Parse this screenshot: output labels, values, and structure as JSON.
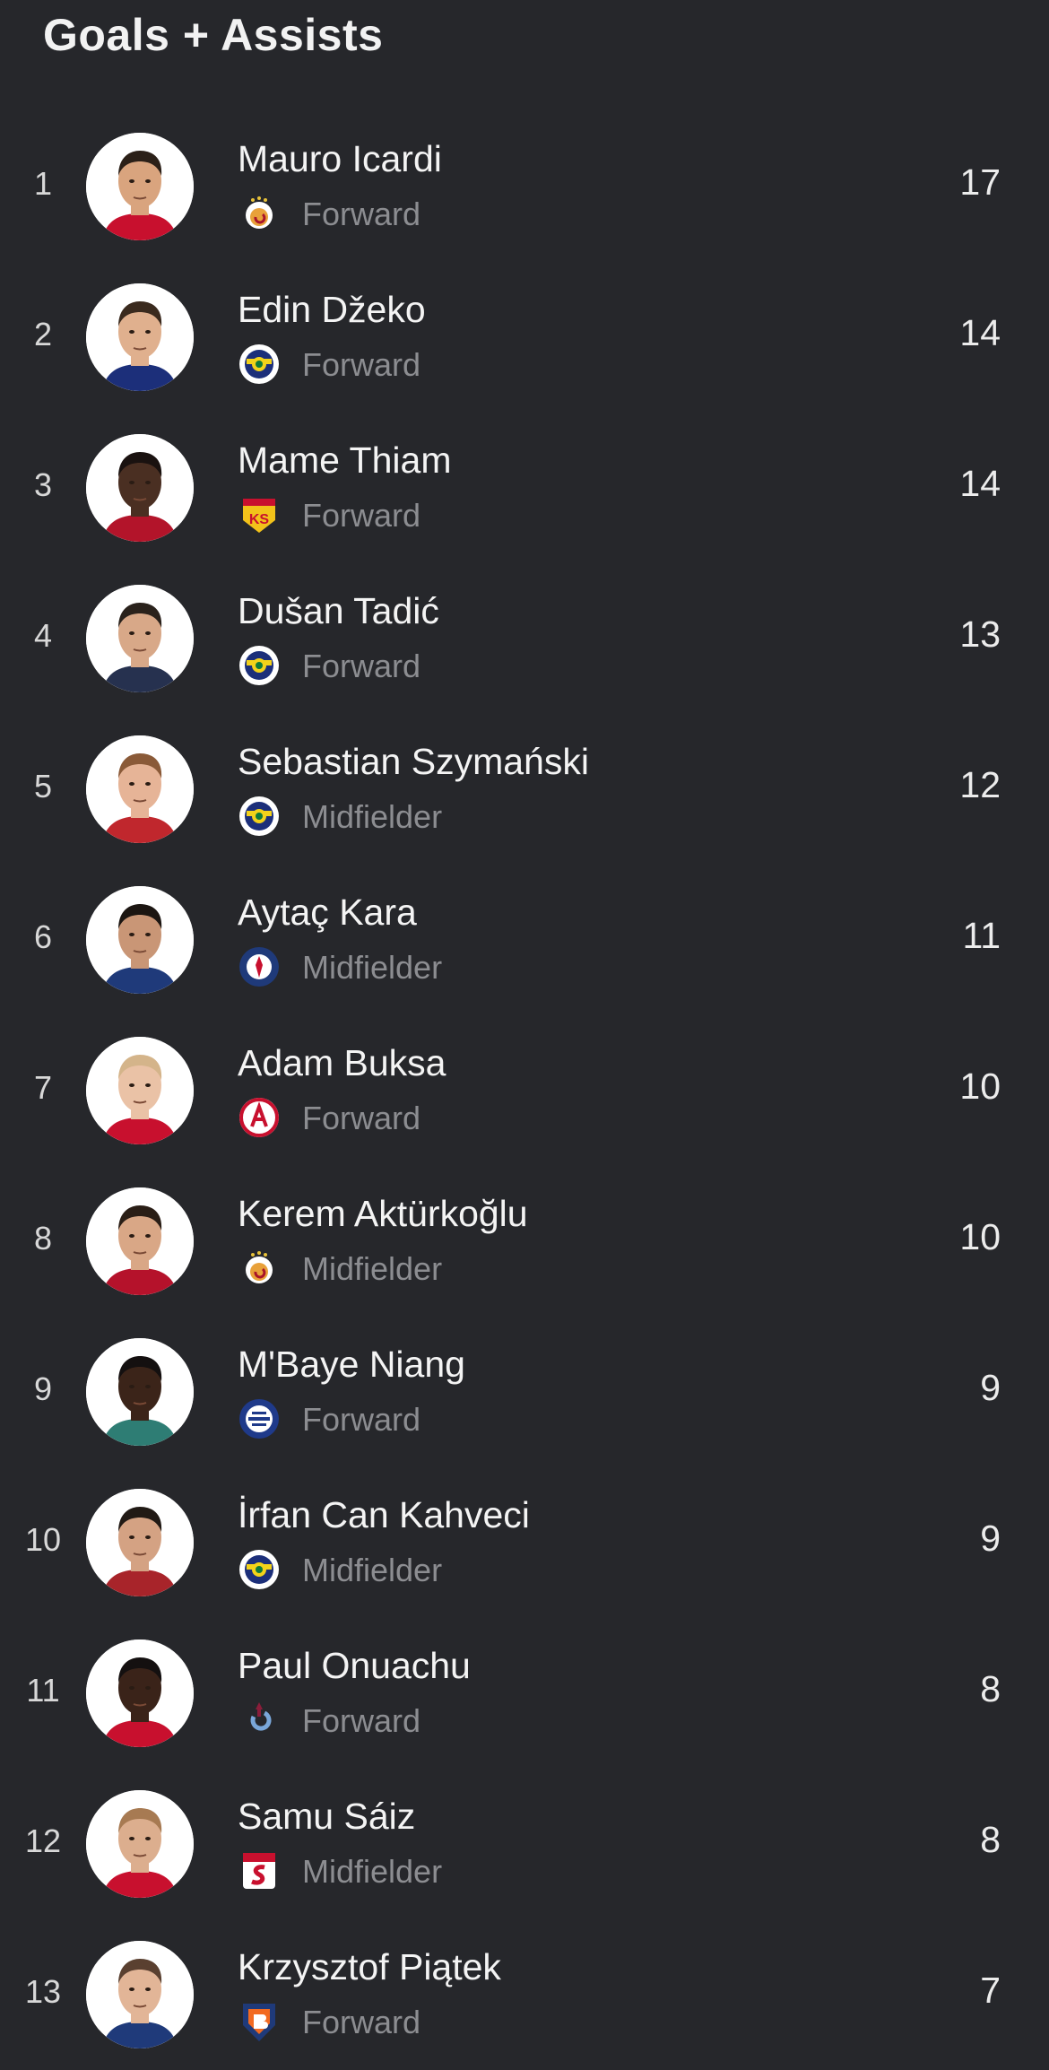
{
  "title": "Goals + Assists",
  "colors": {
    "background": "#26272b",
    "text_primary": "#f4f4f4",
    "text_secondary": "#8c8d91"
  },
  "players": [
    {
      "rank": "1",
      "name": "Mauro Icardi",
      "position": "Forward",
      "value": "17",
      "club_icon": "galatasaray-crest-icon",
      "skin": "#d9a47e",
      "hair": "#2b2018",
      "shirt": "#c8102e"
    },
    {
      "rank": "2",
      "name": "Edin Džeko",
      "position": "Forward",
      "value": "14",
      "club_icon": "fenerbahce-crest-icon",
      "skin": "#e0b08e",
      "hair": "#3a2a1e",
      "shirt": "#1c2f7a"
    },
    {
      "rank": "3",
      "name": "Mame Thiam",
      "position": "Forward",
      "value": "14",
      "club_icon": "kayserispor-crest-icon",
      "skin": "#4a2f22",
      "hair": "#1a1210",
      "shirt": "#b3142a"
    },
    {
      "rank": "4",
      "name": "Dušan Tadić",
      "position": "Forward",
      "value": "13",
      "club_icon": "fenerbahce-crest-icon",
      "skin": "#d8a888",
      "hair": "#2a221c",
      "shirt": "#26314f"
    },
    {
      "rank": "5",
      "name": "Sebastian Szymański",
      "position": "Midfielder",
      "value": "12",
      "club_icon": "fenerbahce-crest-icon",
      "skin": "#e6b497",
      "hair": "#8a5a38",
      "shirt": "#c0272d"
    },
    {
      "rank": "6",
      "name": "Aytaç Kara",
      "position": "Midfielder",
      "value": "11",
      "club_icon": "kasimpasa-crest-icon",
      "skin": "#c99676",
      "hair": "#1c1612",
      "shirt": "#1f3a7a"
    },
    {
      "rank": "7",
      "name": "Adam Buksa",
      "position": "Forward",
      "value": "10",
      "club_icon": "antalyaspor-crest-icon",
      "skin": "#eac2a6",
      "hair": "#d4b48a",
      "shirt": "#c8102e"
    },
    {
      "rank": "8",
      "name": "Kerem Aktürkoğlu",
      "position": "Midfielder",
      "value": "10",
      "club_icon": "galatasaray-crest-icon",
      "skin": "#d9a786",
      "hair": "#2a1e16",
      "shirt": "#b5122b"
    },
    {
      "rank": "9",
      "name": "M'Baye Niang",
      "position": "Forward",
      "value": "9",
      "club_icon": "adana-demirspor-crest-icon",
      "skin": "#3b2419",
      "hair": "#141010",
      "shirt": "#2e7d74"
    },
    {
      "rank": "10",
      "name": "İrfan Can Kahveci",
      "position": "Midfielder",
      "value": "9",
      "club_icon": "fenerbahce-crest-icon",
      "skin": "#d4a283",
      "hair": "#211a15",
      "shirt": "#a8242a"
    },
    {
      "rank": "11",
      "name": "Paul Onuachu",
      "position": "Forward",
      "value": "8",
      "club_icon": "trabzonspor-crest-icon",
      "skin": "#3a2319",
      "hair": "#141010",
      "shirt": "#c8102e"
    },
    {
      "rank": "12",
      "name": "Samu Sáiz",
      "position": "Midfielder",
      "value": "8",
      "club_icon": "sivasspor-crest-icon",
      "skin": "#dcae8e",
      "hair": "#a77a52",
      "shirt": "#c8102e"
    },
    {
      "rank": "13",
      "name": "Krzysztof Piątek",
      "position": "Forward",
      "value": "7",
      "club_icon": "basaksehir-crest-icon",
      "skin": "#e2b597",
      "hair": "#5a4030",
      "shirt": "#1f3a7a"
    }
  ]
}
